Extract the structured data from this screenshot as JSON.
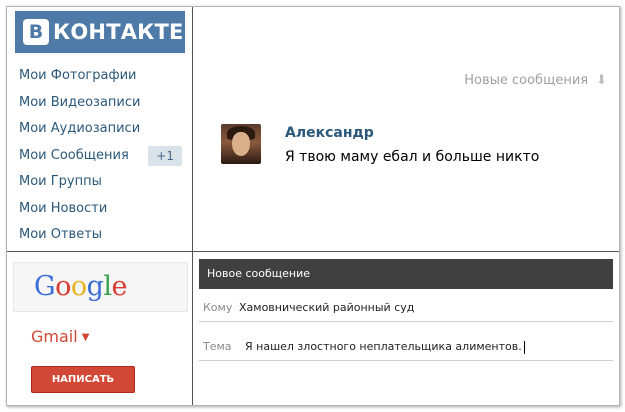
{
  "vk": {
    "logo_letter": "B",
    "logo_word": "КОНТАКТЕ",
    "brand_color": "#4e7aa8"
  },
  "menu": {
    "items": [
      {
        "label": "Мои Фотографии"
      },
      {
        "label": "Мои Видеозаписи"
      },
      {
        "label": "Мои Аудиозаписи"
      },
      {
        "label": "Мои Сообщения",
        "badge": "+1"
      },
      {
        "label": "Мои Группы"
      },
      {
        "label": "Мои Новости"
      },
      {
        "label": "Мои Ответы"
      }
    ]
  },
  "messages": {
    "new_messages_label": "Новые сообщения",
    "arrow_icon": "down-arrow-icon",
    "sender": "Александр",
    "text": "Я твою маму ебал и больше никто"
  },
  "gmail": {
    "label": "Gmail",
    "compose_button": "НАПИСАТЬ",
    "accent": "#d14836"
  },
  "compose": {
    "header": "Новое сообщение",
    "to_label": "Кому",
    "to_value": "Хамовнический районный суд",
    "subject_label": "Тема",
    "subject_value": "Я нашел злостного неплательщика алиментов."
  }
}
